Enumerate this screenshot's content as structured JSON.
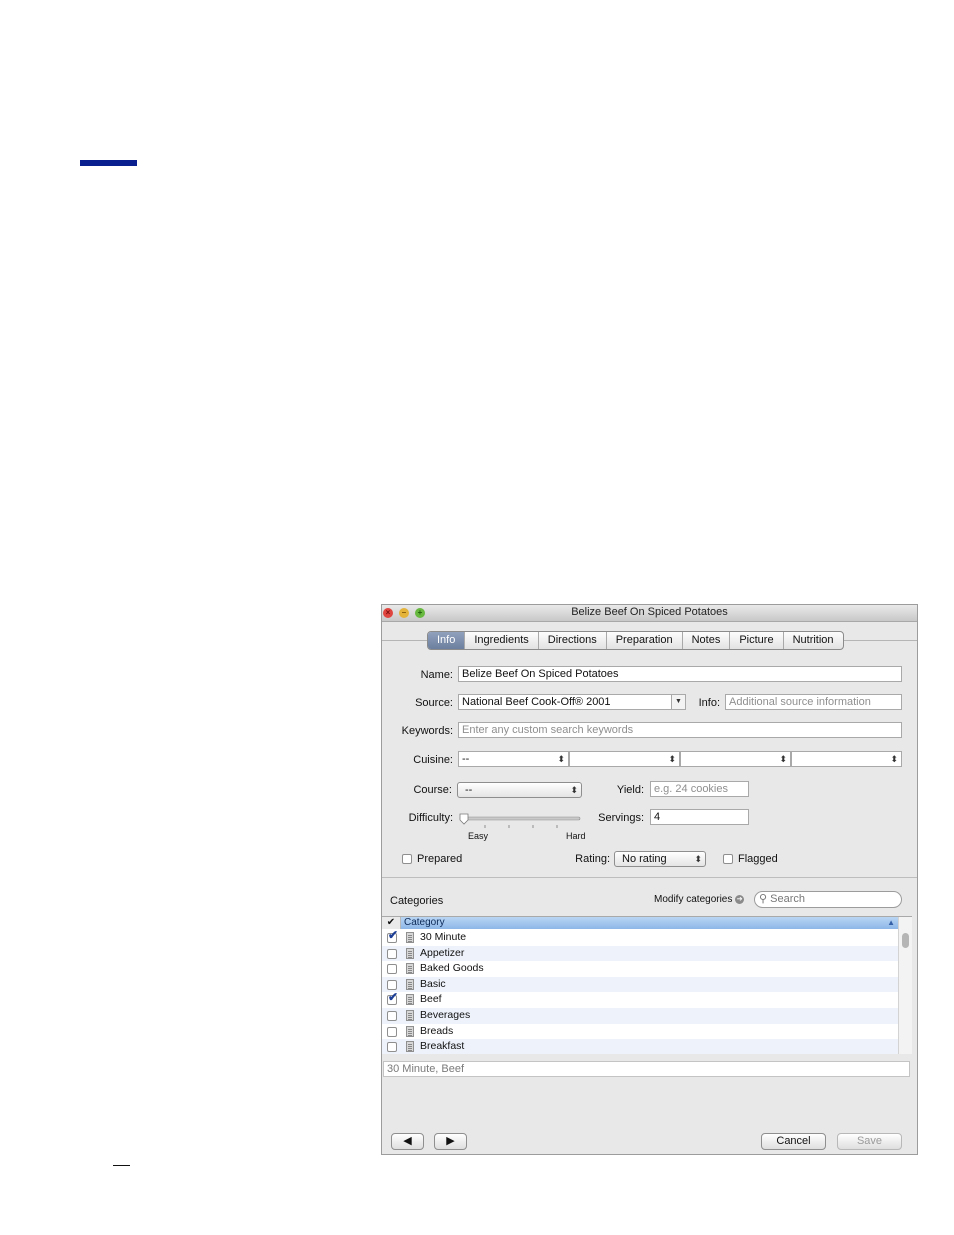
{
  "window": {
    "title": "Belize Beef On Spiced Potatoes"
  },
  "tabs": [
    {
      "label": "Info",
      "active": true
    },
    {
      "label": "Ingredients"
    },
    {
      "label": "Directions"
    },
    {
      "label": "Preparation"
    },
    {
      "label": "Notes"
    },
    {
      "label": "Picture"
    },
    {
      "label": "Nutrition"
    }
  ],
  "form": {
    "name_label": "Name:",
    "name_value": "Belize Beef On Spiced Potatoes",
    "source_label": "Source:",
    "source_value": "National Beef Cook-Off® 2001",
    "info_label": "Info:",
    "info_placeholder": "Additional source information",
    "keywords_label": "Keywords:",
    "keywords_placeholder": "Enter any custom search keywords",
    "cuisine_label": "Cuisine:",
    "cuisine_values": [
      "--",
      "",
      "",
      ""
    ],
    "course_label": "Course:",
    "course_value": "--",
    "yield_label": "Yield:",
    "yield_placeholder": "e.g. 24 cookies",
    "difficulty_label": "Difficulty:",
    "difficulty_easy": "Easy",
    "difficulty_hard": "Hard",
    "difficulty_level": 0,
    "servings_label": "Servings:",
    "servings_value": "4",
    "prepared_label": "Prepared",
    "prepared_checked": false,
    "rating_label": "Rating:",
    "rating_value": "No rating",
    "flagged_label": "Flagged",
    "flagged_checked": false
  },
  "categories": {
    "heading": "Categories",
    "modify_label": "Modify categories",
    "search_placeholder": "Search",
    "check_header": "✔",
    "column_header": "Category",
    "items": [
      {
        "name": "30 Minute",
        "checked": true
      },
      {
        "name": "Appetizer",
        "checked": false
      },
      {
        "name": "Baked Goods",
        "checked": false
      },
      {
        "name": "Basic",
        "checked": false
      },
      {
        "name": "Beef",
        "checked": true
      },
      {
        "name": "Beverages",
        "checked": false
      },
      {
        "name": "Breads",
        "checked": false
      },
      {
        "name": "Breakfast",
        "checked": false
      }
    ],
    "selected_summary": "30 Minute, Beef"
  },
  "footer": {
    "cancel_label": "Cancel",
    "save_label": "Save"
  },
  "colors": {
    "accent_bar": "#0a1f8f",
    "active_tab": "#6c7f9e",
    "table_header": "#8db7e8"
  }
}
